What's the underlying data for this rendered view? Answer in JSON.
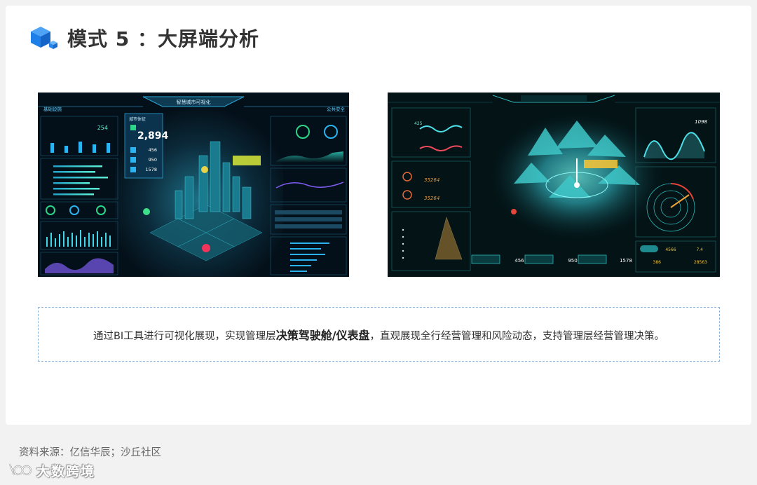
{
  "header": {
    "title": "模式 5 ：大屏端分析",
    "icon": "cube-icon",
    "accent": "#1e7fe8"
  },
  "screenshots": {
    "left": {
      "header_title": "智慧城市可视化",
      "left_tab": "基础设施",
      "right_tab": "公共安全",
      "kpi_label": "城市体征",
      "kpi_value": "2,894",
      "kpi_rows": [
        "456",
        "950",
        "1578"
      ],
      "left_small_value": "254"
    },
    "right": {
      "stat_right_value": "1098",
      "metric_a": "456",
      "metric_b": "950",
      "metric_c": "1578",
      "counter_a": "35264",
      "counter_b": "35264",
      "chip_a": "4566",
      "chip_b": "7.4",
      "chip_c": "386",
      "chip_d": "28563",
      "top_left_value": "425"
    }
  },
  "note": {
    "prefix": "通过BI工具进行可视化展现，实现管理层",
    "bold": "决策驾驶舱/仪表盘",
    "suffix": "，直观展现全行经营管理和风险动态，支持管理层经营管理决策。"
  },
  "source": "资料来源：亿信华辰；沙丘社区",
  "watermark": "大数跨境"
}
